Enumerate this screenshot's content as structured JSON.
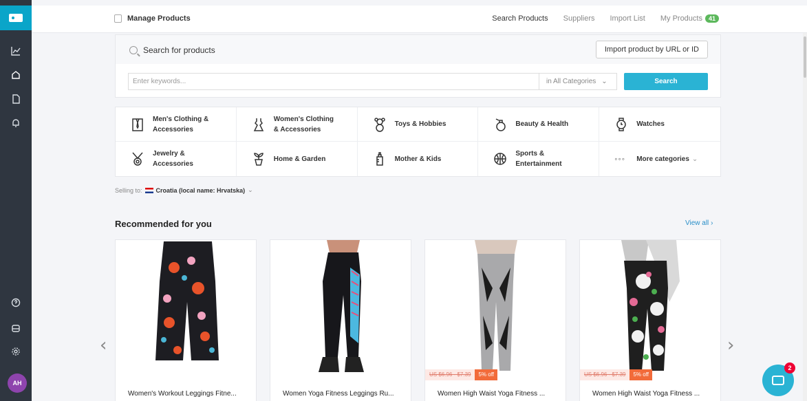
{
  "topbar": {
    "title": "Manage Products",
    "nav": [
      {
        "label": "Search Products"
      },
      {
        "label": "Suppliers"
      },
      {
        "label": "Import List"
      },
      {
        "label": "My Products"
      }
    ],
    "my_products_count": "41"
  },
  "rail": {
    "icons": [
      "chart-icon",
      "store-icon",
      "orders-icon",
      "notifications-icon",
      "help-icon",
      "inbox-icon",
      "settings-icon"
    ],
    "avatar_initials": "AH"
  },
  "search": {
    "label": "Search for products",
    "import_button": "Import product by URL or ID",
    "keywords_placeholder": "Enter keywords...",
    "category_select": "in All Categories",
    "search_button": "Search"
  },
  "categories": [
    {
      "label": "Men's Clothing & Accessories",
      "icon": "shirt-tie-icon"
    },
    {
      "label": "Women's Clothing & Accessories",
      "icon": "dress-icon"
    },
    {
      "label": "Toys & Hobbies",
      "icon": "teddy-bear-icon"
    },
    {
      "label": "Beauty & Health",
      "icon": "perfume-icon"
    },
    {
      "label": "Watches",
      "icon": "watch-icon"
    },
    {
      "label": "Jewelry & Accessories",
      "icon": "necklace-icon"
    },
    {
      "label": "Home & Garden",
      "icon": "plant-pot-icon"
    },
    {
      "label": "Mother & Kids",
      "icon": "baby-bottle-icon"
    },
    {
      "label": "Sports & Entertainment",
      "icon": "basketball-icon"
    },
    {
      "label": "More categories",
      "icon": "more-dots-icon"
    }
  ],
  "selling_to": {
    "prefix": "Selling to:",
    "country": "Croatia (local name: Hrvatska)"
  },
  "recommended": {
    "title": "Recommended for you",
    "view_all": "View all",
    "products": [
      {
        "name": "Women's Workout Leggings Fitne...",
        "price_old": "",
        "discount": ""
      },
      {
        "name": "Women Yoga Fitness Leggings Ru...",
        "price_old": "",
        "discount": ""
      },
      {
        "name": "Women High Waist Yoga Fitness ...",
        "price_old": "US $6.96 - $7.39",
        "discount": "5% off"
      },
      {
        "name": "Women High Waist Yoga Fitness ...",
        "price_old": "US $6.96 - $7.39",
        "discount": "5% off"
      }
    ]
  },
  "chat": {
    "badge": "2"
  },
  "colors": {
    "accent": "#2ab3d4",
    "rail": "#2f3640",
    "count_badge": "#5cb85c",
    "discount": "#f26b3a"
  }
}
